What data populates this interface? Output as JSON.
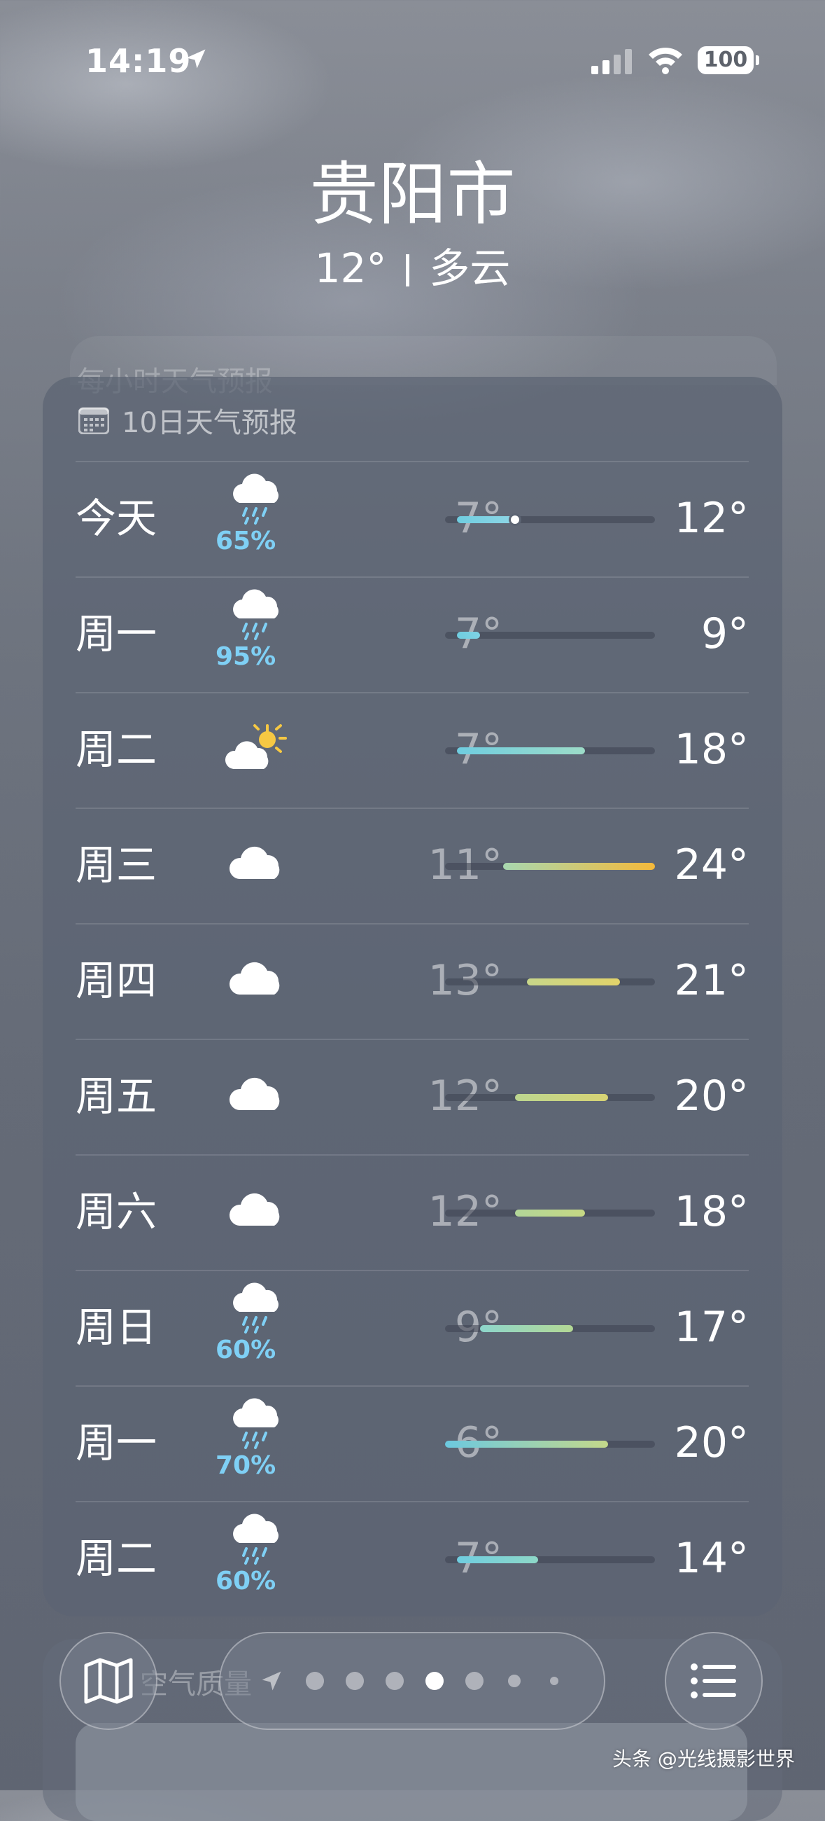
{
  "status_bar": {
    "time": "14:19",
    "battery": "100"
  },
  "header": {
    "city": "贵阳市",
    "temperature": "12°",
    "condition": "多云"
  },
  "ghost_card_title": "每小时天气预报",
  "forecast_card": {
    "title": "10日天气预报",
    "scale": {
      "min": 6,
      "max": 24
    },
    "current_temp": 12,
    "days": [
      {
        "day": "今天",
        "icon": "cloud-rain-icon",
        "precip": "65%",
        "low": "7°",
        "high": "12°",
        "lo": 7,
        "hi": 12,
        "colors": [
          "#6fcde0",
          "#8fd6e6"
        ],
        "now": true
      },
      {
        "day": "周一",
        "icon": "cloud-rain-icon",
        "precip": "95%",
        "low": "7°",
        "high": "9°",
        "lo": 7,
        "hi": 9,
        "colors": [
          "#6fcde0",
          "#7fd2e4"
        ]
      },
      {
        "day": "周二",
        "icon": "partly-sunny-icon",
        "precip": "",
        "low": "7°",
        "high": "18°",
        "lo": 7,
        "hi": 18,
        "colors": [
          "#6fcde0",
          "#9ddcc8"
        ]
      },
      {
        "day": "周三",
        "icon": "cloud-icon",
        "precip": "",
        "low": "11°",
        "high": "24°",
        "lo": 11,
        "hi": 24,
        "colors": [
          "#a8d8b0",
          "#f5b93a"
        ]
      },
      {
        "day": "周四",
        "icon": "cloud-icon",
        "precip": "",
        "low": "13°",
        "high": "21°",
        "lo": 13,
        "hi": 21,
        "colors": [
          "#c8d68a",
          "#e2d36a"
        ]
      },
      {
        "day": "周五",
        "icon": "cloud-icon",
        "precip": "",
        "low": "12°",
        "high": "20°",
        "lo": 12,
        "hi": 20,
        "colors": [
          "#bcd690",
          "#d8d474"
        ]
      },
      {
        "day": "周六",
        "icon": "cloud-icon",
        "precip": "",
        "low": "12°",
        "high": "18°",
        "lo": 12,
        "hi": 18,
        "colors": [
          "#b2d698",
          "#c6d884"
        ]
      },
      {
        "day": "周日",
        "icon": "cloud-rain-icon",
        "precip": "60%",
        "low": "9°",
        "high": "17°",
        "lo": 9,
        "hi": 17,
        "colors": [
          "#8dd6cc",
          "#b4d894"
        ]
      },
      {
        "day": "周一",
        "icon": "cloud-rain-icon",
        "precip": "70%",
        "low": "6°",
        "high": "20°",
        "lo": 6,
        "hi": 20,
        "colors": [
          "#6cc9e0",
          "#c4d88a"
        ]
      },
      {
        "day": "周二",
        "icon": "cloud-rain-icon",
        "precip": "60%",
        "low": "7°",
        "high": "14°",
        "lo": 7,
        "hi": 14,
        "colors": [
          "#6fcde0",
          "#8ed8c8"
        ]
      }
    ]
  },
  "air_quality_title": "空气质量",
  "bottom_bar": {
    "map_icon": "map-icon",
    "list_icon": "list-icon",
    "page_count": 7,
    "active_page": 4
  },
  "watermark": "头条 @光线摄影世界"
}
